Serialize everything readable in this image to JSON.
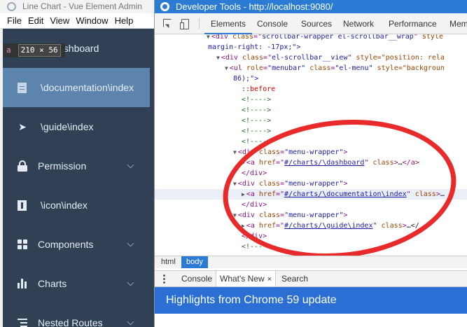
{
  "app": {
    "title": "Line Chart - Vue Element Admin",
    "menu": [
      "File",
      "Edit",
      "View",
      "Window",
      "Help"
    ],
    "inspect_tooltip": {
      "tag": "a",
      "size": "210 × 56"
    },
    "sidebar": [
      {
        "label": "ashboard",
        "icon": "dashboard-icon",
        "active": false,
        "expandable": false
      },
      {
        "label": "\\documentation\\index",
        "icon": "documentation-icon",
        "active": true,
        "expandable": false
      },
      {
        "label": "\\guide\\index",
        "icon": "send-icon",
        "active": false,
        "expandable": false
      },
      {
        "label": "Permission",
        "icon": "lock-icon",
        "active": false,
        "expandable": true
      },
      {
        "label": "\\icon\\index",
        "icon": "icon-box-icon",
        "active": false,
        "expandable": false
      },
      {
        "label": "Components",
        "icon": "grid-icon",
        "active": false,
        "expandable": true
      },
      {
        "label": "Charts",
        "icon": "bar-chart-icon",
        "active": false,
        "expandable": true
      },
      {
        "label": "Nested Routes",
        "icon": "nested-list-icon",
        "active": false,
        "expandable": true
      }
    ],
    "colors": {
      "sidebar_bg": "#304156",
      "active_item": "#5d84ad"
    }
  },
  "devtools": {
    "title": "Developer Tools - http://localhost:9080/",
    "tabs": [
      "Elements",
      "Console",
      "Sources",
      "Network",
      "Performance",
      "Memory"
    ],
    "active_tab": "Elements",
    "dom": {
      "l1_attr_val": "scrollbar-wrapper el-scrollbar__wrap",
      "l1_style": "style",
      "l2_text": "margin-right: -17px;\">",
      "l3_attr_val": "el-scrollbar__view",
      "l3_style": "style=\"position: rela",
      "l4_role": "\"menubar\"",
      "l4_class": "\"el-menu\"",
      "l4_style": "style=\"backgroun",
      "l5_text": "86);\">",
      "pseudo": "::before",
      "comment": "<!---->",
      "wrapper_class": "\"menu-wrapper\"",
      "href_dashboard": "#/charts/\\dashboard",
      "href_documentation": "#/charts/\\documentation\\index",
      "href_guide": "#/charts/\\guide\\index",
      "class_attr": "class",
      "ellipsis": "…",
      "tail": "</a>",
      "tail_cut": "…</",
      "div_close": "</div>",
      "div_open": "<div",
      "a_open": "<a",
      "href": "href",
      "ul_open": "<ul",
      "class_kw": "class",
      "role_kw": "role",
      "eq": "=",
      "gt": ">",
      "lt_a_close": "</a>"
    },
    "breadcrumbs": [
      "html",
      "body"
    ],
    "active_crumb": "body",
    "drawer_tabs": [
      "Console",
      "What's New",
      "Search"
    ],
    "active_drawer_tab": "What's New",
    "close_glyph": "×",
    "banner": "Highlights from Chrome 59 update"
  }
}
